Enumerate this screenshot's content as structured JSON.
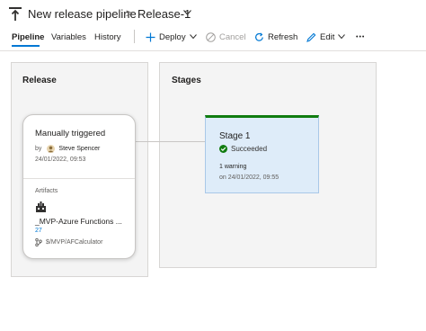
{
  "breadcrumb": {
    "pipeline_name": "New release pipeline",
    "separator": ">",
    "release_name": "Release-1"
  },
  "tabs": [
    {
      "label": "Pipeline",
      "active": true
    },
    {
      "label": "Variables",
      "active": false
    },
    {
      "label": "History",
      "active": false
    }
  ],
  "toolbar": {
    "deploy": "Deploy",
    "cancel": "Cancel",
    "refresh": "Refresh",
    "edit": "Edit",
    "more": "•••"
  },
  "colors": {
    "accent": "#0078d4",
    "success": "#107c10",
    "stage_bg": "#deecf9"
  },
  "release_section": {
    "title": "Release",
    "card": {
      "title": "Manually triggered",
      "by_prefix": "by",
      "user": "Steve Spencer",
      "date": "24/01/2022, 09:53",
      "artifacts_label": "Artifacts",
      "artifact_name": "_MVP-Azure Functions ...",
      "artifact_version": "27",
      "artifact_branch": "$/MVP/AFCalculator"
    }
  },
  "stages_section": {
    "title": "Stages",
    "stage": {
      "name": "Stage 1",
      "status": "Succeeded",
      "warnings": "1 warning",
      "when": "on 24/01/2022, 09:55"
    }
  }
}
